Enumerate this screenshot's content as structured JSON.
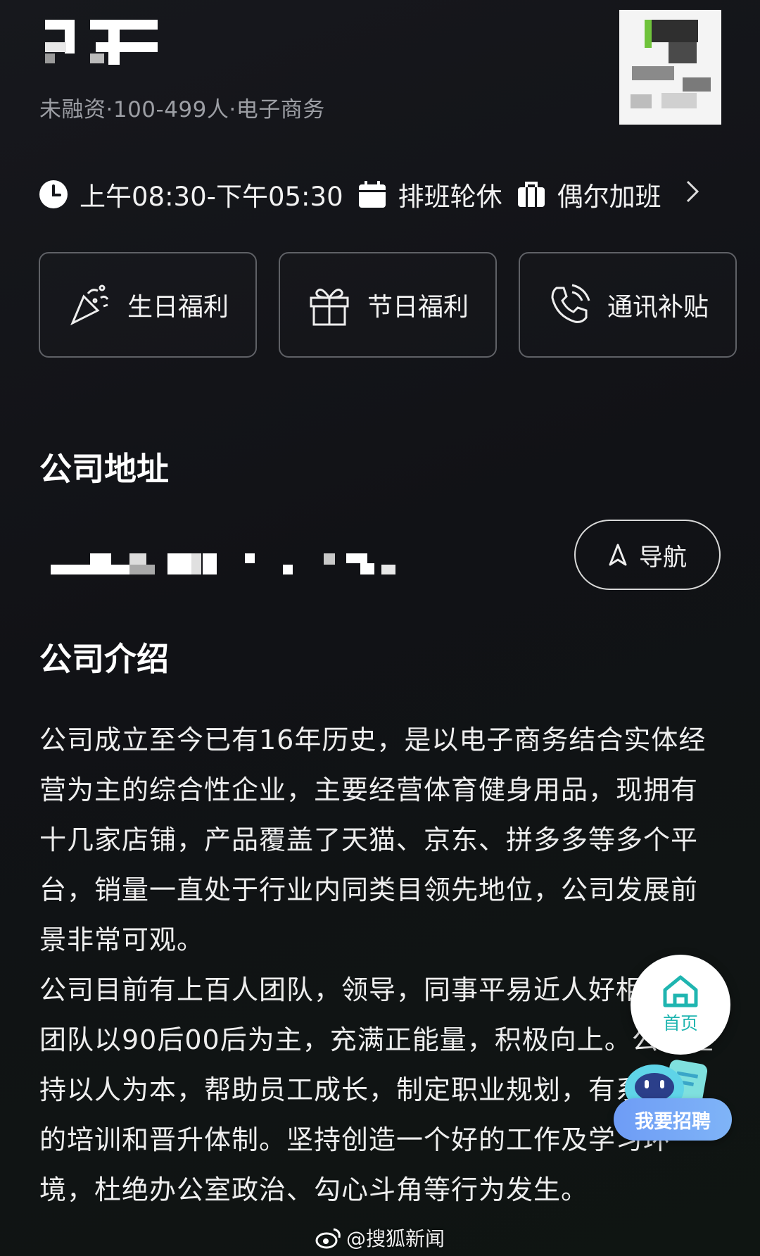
{
  "company": {
    "meta": "未融资·100-499人·电子商务"
  },
  "schedule": {
    "work_time": "上午08:30-下午05:30",
    "shift": "排班轮休",
    "overtime": "偶尔加班"
  },
  "benefits": [
    {
      "label": "生日福利",
      "icon": "party-popper-icon"
    },
    {
      "label": "节日福利",
      "icon": "gift-icon"
    },
    {
      "label": "通讯补贴",
      "icon": "phone-call-icon"
    }
  ],
  "address": {
    "title": "公司地址",
    "nav_label": "导航"
  },
  "intro": {
    "title": "公司介绍",
    "paragraphs": [
      "公司成立至今已有16年历史，是以电子商务结合实体经营为主的综合性企业，主要经营体育健身用品，现拥有十几家店铺，产品覆盖了天猫、京东、拼多多等多个平台，销量一直处于行业内同类目领先地位，公司发展前景非常可观。",
      "公司目前有上百人团队，领导，同事平易近人好相处，团队以90后00后为主，充满正能量，积极向上。公司坚持以人为本，帮助员工成长，制定职业规划，有系统性的培训和晋升体制。坚持创造一个好的工作及学习环境，杜绝办公室政治、勾心斗角等行为发生。"
    ]
  },
  "floating": {
    "home_label": "首页",
    "recruit_label": "我要招聘"
  },
  "watermark": "@搜狐新闻",
  "colors": {
    "background": "#131418",
    "accent_teal": "#1fb5b0",
    "recruit_blue": "#6e9cf6"
  }
}
